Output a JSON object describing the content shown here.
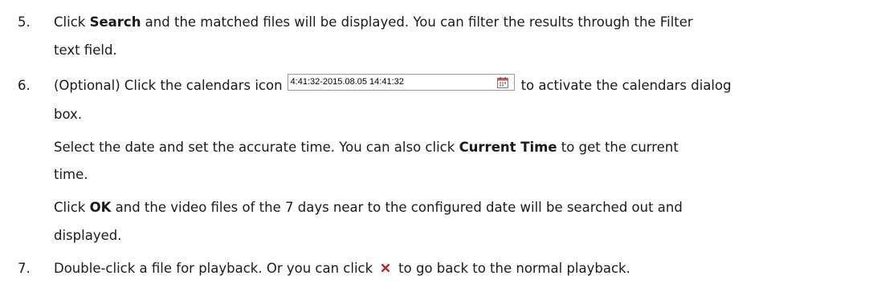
{
  "steps": [
    {
      "number": "5.",
      "lines": [
        {
          "pre": "Click ",
          "bold": "Search",
          "post": " and the matched files will be displayed. You can filter the results through the Filter"
        },
        {
          "text": "text field."
        }
      ]
    },
    {
      "number": "6.",
      "lines": [
        {
          "pre": "(Optional) Click the calendars icon",
          "widget_time": "4:41:32-2015.08.05 14:41:32",
          "widget_icon": "calendar-icon",
          "post": "to activate the calendars dialog"
        },
        {
          "text": "box."
        },
        {
          "pre": "Select the date and set the accurate time. You can also click ",
          "bold": "Current Time",
          "post": " to get the current"
        },
        {
          "text": "time."
        },
        {
          "pre": "Click ",
          "bold": "OK",
          "post": " and the video files of the 7 days near to the configured date will be searched out and"
        },
        {
          "text": "displayed."
        }
      ]
    },
    {
      "number": "7.",
      "lines": [
        {
          "pre": "Double-click a file for playback. Or you can click",
          "icon": "close-red-x-icon",
          "post": "to go back to the normal playback."
        }
      ]
    }
  ],
  "colors": {
    "text": "#1a1a1a",
    "x_icon_red": "#d4262b",
    "calendar_accent": "#d9534f",
    "widget_border": "#9a9a9a"
  }
}
